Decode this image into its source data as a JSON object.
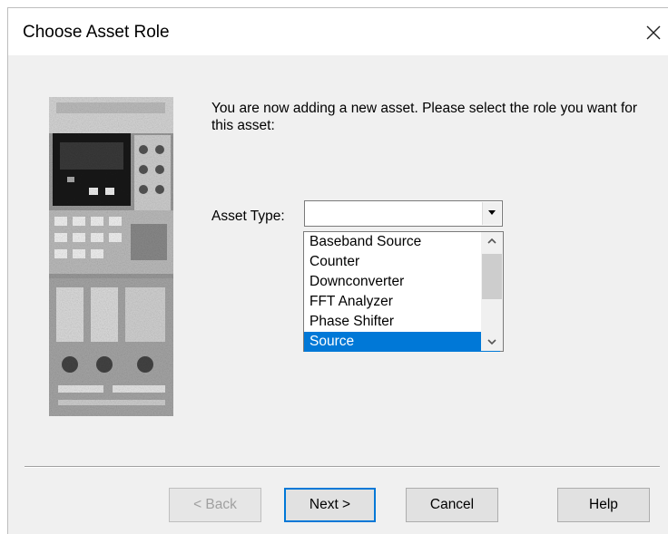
{
  "window": {
    "title": "Choose Asset Role",
    "close_icon": "close-icon"
  },
  "content": {
    "intro_text": "You are now adding a new asset.  Please select the role you want for this asset:",
    "asset_type_label": "Asset Type:",
    "asset_type_value": ""
  },
  "listbox": {
    "items": [
      {
        "label": "Baseband Source",
        "selected": false
      },
      {
        "label": "Counter",
        "selected": false
      },
      {
        "label": "Downconverter",
        "selected": false
      },
      {
        "label": "FFT Analyzer",
        "selected": false
      },
      {
        "label": "Phase Shifter",
        "selected": false
      },
      {
        "label": "Source",
        "selected": true
      }
    ]
  },
  "buttons": {
    "back": "< Back",
    "next": "Next >",
    "cancel": "Cancel",
    "help": "Help"
  },
  "colors": {
    "selection": "#0078d7",
    "dialog_bg": "#f0f0f0",
    "default_button_border": "#0078d7"
  }
}
